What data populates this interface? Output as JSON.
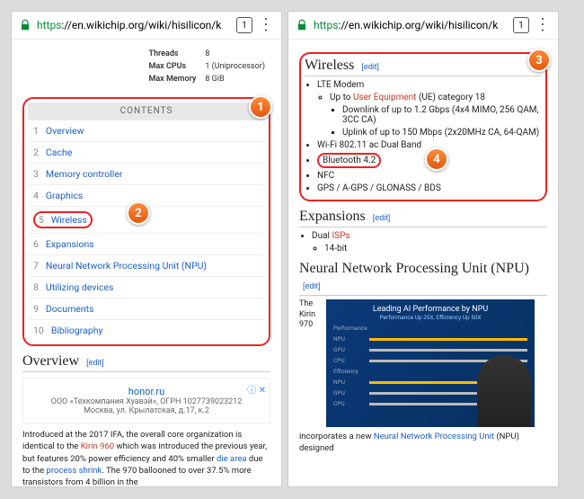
{
  "url": {
    "https": "https",
    "rest": "://en.wikichip.org/wiki/hisilicon/k"
  },
  "tabcount": "1",
  "infobox": {
    "threads_lbl": "Threads",
    "threads": "8",
    "maxcpu_lbl": "Max CPUs",
    "maxcpu": "1 (Uniprocessor)",
    "maxmem_lbl": "Max Memory",
    "maxmem": "8 GiB"
  },
  "badges": {
    "b1": "1",
    "b2": "2",
    "b3": "3",
    "b4": "4"
  },
  "toc_header": "CONTENTS",
  "toc": [
    {
      "n": "1",
      "t": "Overview"
    },
    {
      "n": "2",
      "t": "Cache"
    },
    {
      "n": "3",
      "t": "Memory controller"
    },
    {
      "n": "4",
      "t": "Graphics"
    },
    {
      "n": "5",
      "t": "Wireless"
    },
    {
      "n": "6",
      "t": "Expansions"
    },
    {
      "n": "7",
      "t": "Neural Network Processing Unit (NPU)"
    },
    {
      "n": "8",
      "t": "Utilizing devices"
    },
    {
      "n": "9",
      "t": "Documents"
    },
    {
      "n": "10",
      "t": "Bibliography"
    }
  ],
  "overview": {
    "title": "Overview",
    "edit": "[edit]"
  },
  "ad": {
    "domain": "honor.ru",
    "line1": "ООО «Техкомпания Хуавэй», ОГРН 1027739023212",
    "line2": "Москва, ул. Крылатская, д.17, к.2"
  },
  "para": {
    "p1a": "Introduced at the 2017 IFA, the overall core organization is identical to the ",
    "kirin": "Kirin 960",
    "p1b": " which was introduced the previous year, but features 20% power efficiency and 40% smaller ",
    "die": "die area",
    "p1c": " due to the ",
    "shrink": "process shrink",
    "p1d": ". The 970 ballooned to over 37.5% more transistors from 4 billion in the"
  },
  "wireless": {
    "title": "Wireless",
    "edit": "[edit]",
    "lte": "LTE Modem",
    "ue1": "Up to ",
    "ue2": "User Equipment",
    "ue3": " (UE) category 18",
    "dl": "Downlink of up to 1.2 Gbps (4x4 MIMO, 256 QAM, 3CC CA)",
    "ul": "Uplink of up to 150 Mbps (2x20MHz CA, 64-QAM)",
    "wifi": "Wi-Fi 802.11 ac Dual Band",
    "bt": "Bluetooth 4.2",
    "nfc": "NFC",
    "gps": "GPS / A-GPS / GLONASS / BDS"
  },
  "expansions": {
    "title": "Expansions",
    "edit": "[edit]",
    "dual": "Dual ",
    "isp": "ISPs",
    "bits": "14-bit"
  },
  "npu": {
    "title": "Neural Network Processing Unit (NPU)",
    "edit": "[edit]",
    "the": "The",
    "kirin": "Kirin",
    "num": "970",
    "slide_title": "Leading AI Performance by NPU",
    "slide_sub": "Performance Up 25X, Efficiency Up 50X",
    "row1": "Performance",
    "row2": "Efficiency",
    "tail1": "incorporates a new ",
    "link": "Neural Network Processing Unit",
    "tail2": " (NPU) designed"
  }
}
